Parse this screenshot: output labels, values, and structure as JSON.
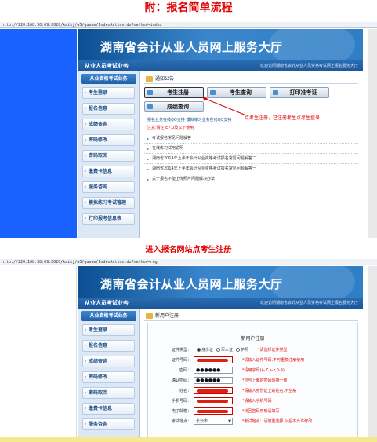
{
  "doc": {
    "title": "附：报名简单流程",
    "caption2": "进入报名网站点考生注册"
  },
  "browser": {
    "url1": "http://220.168.30.69:8020/kaikj/w5/queue/IndexAction.do?method=index",
    "url2": "http://220.168.30.69:8020/kaikj/w5/queue/IndexAction.do?method=reg"
  },
  "site": {
    "title": "湖南省会计从业人员网上服务大厅",
    "subbar": "从业人员考试业务",
    "welcome": "欢迎访问湖南省会计从业人员资格考试网上报名服务大厅",
    "sidebar_head": "从业资格考试业务",
    "sidebar": [
      "考生登录",
      "报名信息",
      "成绩查询",
      "密码修改",
      "密码取回",
      "缴费卡信息",
      "服务咨询",
      "模拟练习考试管理",
      "打印报考信息表"
    ],
    "sidebar2": [
      "考生登录",
      "报名信息",
      "成绩查询",
      "密码修改",
      "密码取回",
      "缴费卡信息",
      "服务咨询"
    ]
  },
  "notice": {
    "header": "通知公告",
    "buttons": [
      "考生注册",
      "考生查询",
      "打印准考证",
      "成绩查询"
    ],
    "link_line": "报名业务在线QQ支持  模拟练习业务在线QQ支持",
    "red_line": "注意:请在IE7.0及以下使用",
    "items": [
      "考试报名常见问题解答",
      "在线练习试用说明",
      "湖南省2014年上半年会计从业资格考试报名常见问题解答二",
      "湖南省2014年上半年会计从业资格考试报名常见问题解答一",
      "关于报名不能上传照片问题解决办法"
    ],
    "annotation": "点考生注册，已注册考生点考生登录"
  },
  "register": {
    "header": "新用户注册",
    "form_title": "新用户注册",
    "id_type_label": "证件类型：",
    "id_types": [
      "身份证",
      "军人证",
      "护照"
    ],
    "id_type_hint": "*请选择证件类型",
    "id_no_label": "证件号码：",
    "id_no_hint": "*请输入证件号码,不可重复注册使用",
    "pwd_label": "密码：",
    "pwd_value": "●●●●●●",
    "pwd_hint": "*请用字母(A-Z,a-z,0-9)",
    "pwd2_label": "确认密码：",
    "pwd2_value": "●●●●●●",
    "pwd2_hint": "*应与上面的密码保持一致",
    "name_label": "姓名：",
    "name_hint": "*请输入身份证上的姓名,不空格",
    "phone_label": "手机号码：",
    "phone_hint": "*请输入手机号码",
    "email_label": "电子邮箱：",
    "email_hint": "*找回密码用到请填写",
    "area_label": "考试地点：",
    "area_value": "长沙市",
    "area_hint": "*考试地点：请慎重选择,以后不允许修改"
  }
}
